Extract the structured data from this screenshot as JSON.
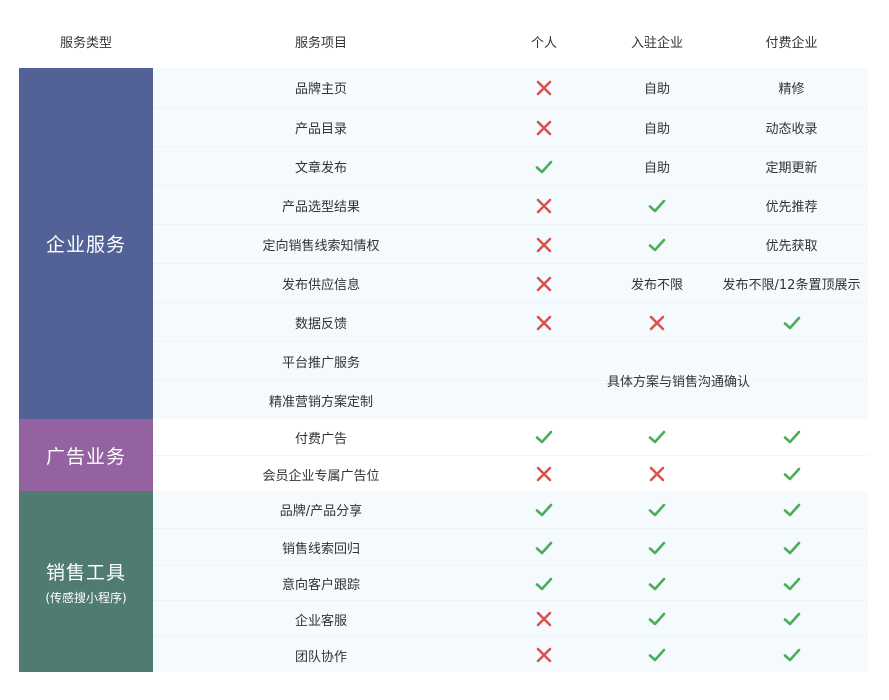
{
  "columns": [
    "服务类型",
    "服务项目",
    "个人",
    "入驻企业",
    "付费企业"
  ],
  "colors": {
    "enterprise": "#526296",
    "ads": "#9562a1",
    "sales": "#4f7b72",
    "light_band": "#f4fafd",
    "check": "#4cae58",
    "cross": "#d9534f"
  },
  "groups": [
    {
      "name": "企业服务",
      "sub": "",
      "color": "#526296",
      "rows": [
        {
          "item": "品牌主页",
          "cells": [
            "cross",
            "自助",
            "精修"
          ]
        },
        {
          "item": "产品目录",
          "cells": [
            "cross",
            "自助",
            "动态收录"
          ]
        },
        {
          "item": "文章发布",
          "cells": [
            "check",
            "自助",
            "定期更新"
          ]
        },
        {
          "item": "产品选型结果",
          "cells": [
            "cross",
            "check",
            "优先推荐"
          ]
        },
        {
          "item": "定向销售线索知情权",
          "cells": [
            "cross",
            "check",
            "优先获取"
          ]
        },
        {
          "item": "发布供应信息",
          "cells": [
            "cross",
            "发布不限",
            "发布不限/12条置顶展示"
          ]
        },
        {
          "item": "数据反馈",
          "cells": [
            "cross",
            "cross",
            "check"
          ]
        },
        {
          "item": "平台推广服务",
          "cells": []
        },
        {
          "item": "精准营销方案定制",
          "cells": []
        }
      ],
      "merged_note": "具体方案与销售沟通确认"
    },
    {
      "name": "广告业务",
      "sub": "",
      "color": "#9562a1",
      "rows": [
        {
          "item": "付费广告",
          "cells": [
            "check",
            "check",
            "check"
          ]
        },
        {
          "item": "会员企业专属广告位",
          "cells": [
            "cross",
            "cross",
            "check"
          ]
        }
      ]
    },
    {
      "name": "销售工具",
      "sub": "(传感搜小程序)",
      "color": "#4f7b72",
      "rows": [
        {
          "item": "品牌/产品分享",
          "cells": [
            "check",
            "check",
            "check"
          ]
        },
        {
          "item": "销售线索回归",
          "cells": [
            "check",
            "check",
            "check"
          ]
        },
        {
          "item": "意向客户跟踪",
          "cells": [
            "check",
            "check",
            "check"
          ]
        },
        {
          "item": "企业客服",
          "cells": [
            "cross",
            "check",
            "check"
          ]
        },
        {
          "item": "团队协作",
          "cells": [
            "cross",
            "check",
            "check"
          ]
        }
      ]
    }
  ]
}
